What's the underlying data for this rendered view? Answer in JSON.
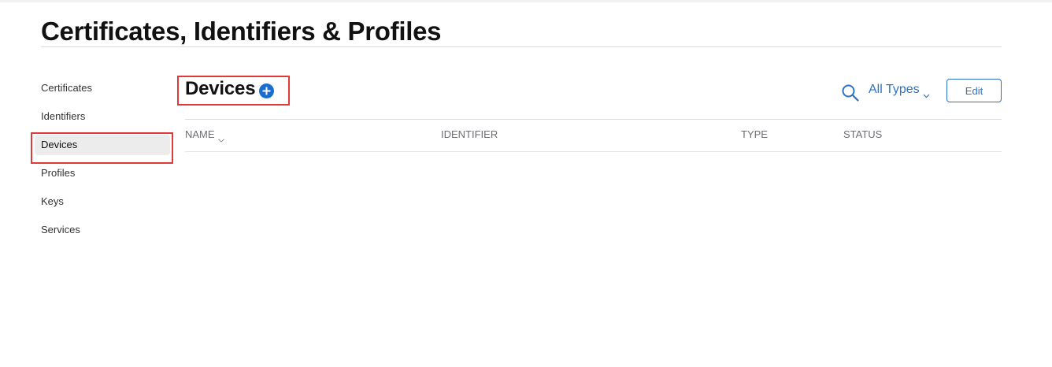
{
  "page": {
    "title": "Certificates, Identifiers & Profiles"
  },
  "sidebar": {
    "items": [
      {
        "label": "Certificates",
        "active": false
      },
      {
        "label": "Identifiers",
        "active": false
      },
      {
        "label": "Devices",
        "active": true
      },
      {
        "label": "Profiles",
        "active": false
      },
      {
        "label": "Keys",
        "active": false
      },
      {
        "label": "Services",
        "active": false
      }
    ]
  },
  "section": {
    "title": "Devices",
    "add_icon": "plus-circle-icon"
  },
  "toolbar": {
    "search_icon": "search-icon",
    "filter_label": "All Types",
    "filter_icon": "chevron-down-icon",
    "edit_label": "Edit"
  },
  "table": {
    "columns": [
      {
        "label": "NAME",
        "sortable": true
      },
      {
        "label": "IDENTIFIER",
        "sortable": false
      },
      {
        "label": "TYPE",
        "sortable": false
      },
      {
        "label": "STATUS",
        "sortable": false
      }
    ],
    "rows": []
  },
  "colors": {
    "accent": "#2b73c5",
    "add_icon": "#1a6dd0",
    "highlight": "#e0393a",
    "active_item_bg": "#ececec"
  }
}
